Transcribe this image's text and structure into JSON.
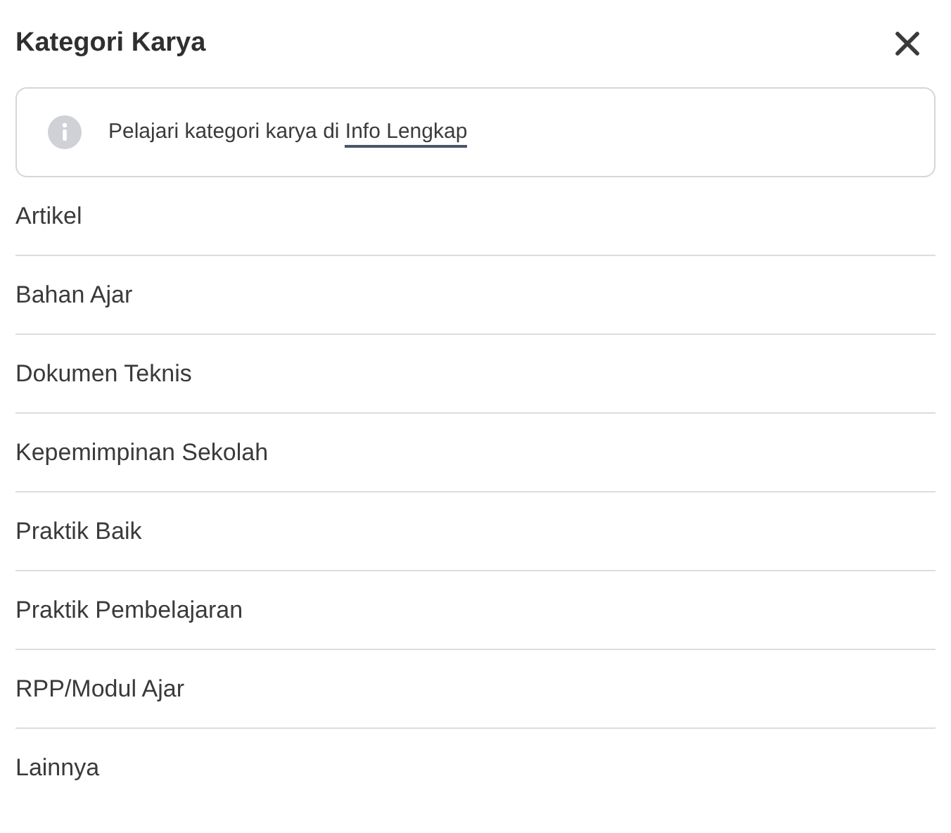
{
  "dialog": {
    "title": "Kategori Karya"
  },
  "info": {
    "text": "Pelajari kategori karya di",
    "link": "Info Lengkap"
  },
  "categories": [
    "Artikel",
    "Bahan Ajar",
    "Dokumen Teknis",
    "Kepemimpinan Sekolah",
    "Praktik Baik",
    "Praktik Pembelajaran",
    "RPP/Modul Ajar",
    "Lainnya"
  ]
}
